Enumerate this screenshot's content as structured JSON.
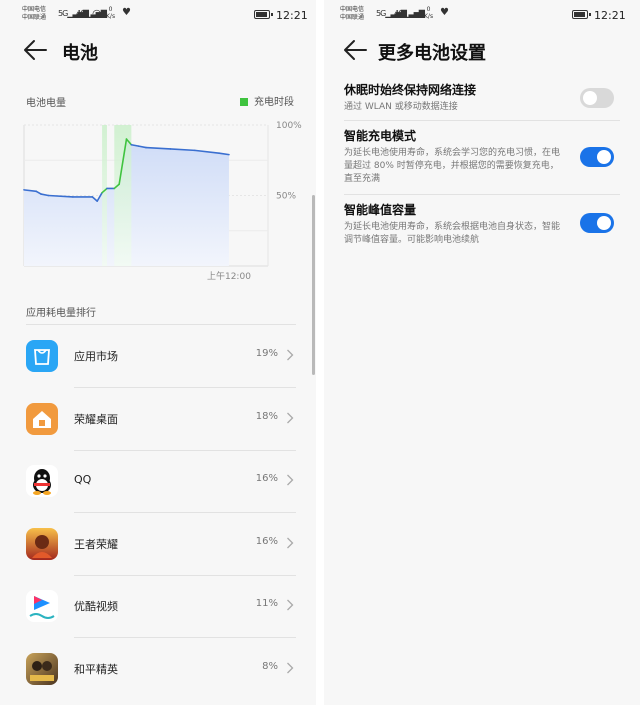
{
  "status_bar": {
    "carrier_1": "中国电信",
    "carrier_2": "中国联通",
    "net_1": "5G",
    "net_2": "4G",
    "speed_value": "0",
    "speed_unit": "K/s",
    "time": "12:21"
  },
  "left": {
    "title": "电池",
    "chart_label": "电池电量",
    "legend_label": "充电时段",
    "section_title": "应用耗电量排行",
    "apps": [
      {
        "name": "应用市场",
        "percent": "19%",
        "icon": "app-market-icon"
      },
      {
        "name": "荣耀桌面",
        "percent": "18%",
        "icon": "honor-home-icon"
      },
      {
        "name": "QQ",
        "percent": "16%",
        "icon": "qq-icon"
      },
      {
        "name": "王者荣耀",
        "percent": "16%",
        "icon": "honor-of-kings-icon"
      },
      {
        "name": "优酷视频",
        "percent": "11%",
        "icon": "youku-icon"
      },
      {
        "name": "和平精英",
        "percent": "8%",
        "icon": "game-for-peace-icon"
      }
    ]
  },
  "right": {
    "title": "更多电池设置",
    "settings": [
      {
        "title": "休眠时始终保持网络连接",
        "desc": "通过 WLAN 或移动数据连接",
        "enabled": false
      },
      {
        "title": "智能充电模式",
        "desc": "为延长电池使用寿命，系统会学习您的充电习惯，在电量超过 80% 时暂停充电，并根据您的需要恢复充电，直至充满",
        "enabled": true
      },
      {
        "title": "智能峰值容量",
        "desc": "为延长电池使用寿命，系统会根据电池自身状态，智能调节峰值容量。可能影响电池续航",
        "enabled": true
      }
    ]
  },
  "colors": {
    "accent": "#1a73e8",
    "charge": "#3fc33f",
    "line": "#3a6fd0"
  },
  "chart_data": {
    "type": "area",
    "ylabel": "",
    "xlabel": "",
    "y_tick_labels": [
      "100%",
      "50%"
    ],
    "y_ticks": [
      100,
      50
    ],
    "x_tick_labels": [
      "上午12:00"
    ],
    "x_ticks": [
      0.84
    ],
    "ylim": [
      0,
      100
    ],
    "xlim": [
      0,
      1
    ],
    "grid": true,
    "legend": "top-right",
    "x": [
      0.0,
      0.05,
      0.07,
      0.1,
      0.2,
      0.28,
      0.3,
      0.32,
      0.34,
      0.37,
      0.39,
      0.42,
      0.44,
      0.47,
      0.5,
      0.6,
      0.7,
      0.8,
      0.84
    ],
    "values": [
      54,
      53,
      51,
      50,
      49,
      49,
      46,
      52,
      55,
      55,
      58,
      90,
      86,
      85,
      84,
      83,
      82,
      80,
      79
    ],
    "charging_ranges": [
      [
        0.32,
        0.34
      ],
      [
        0.37,
        0.44
      ]
    ]
  }
}
